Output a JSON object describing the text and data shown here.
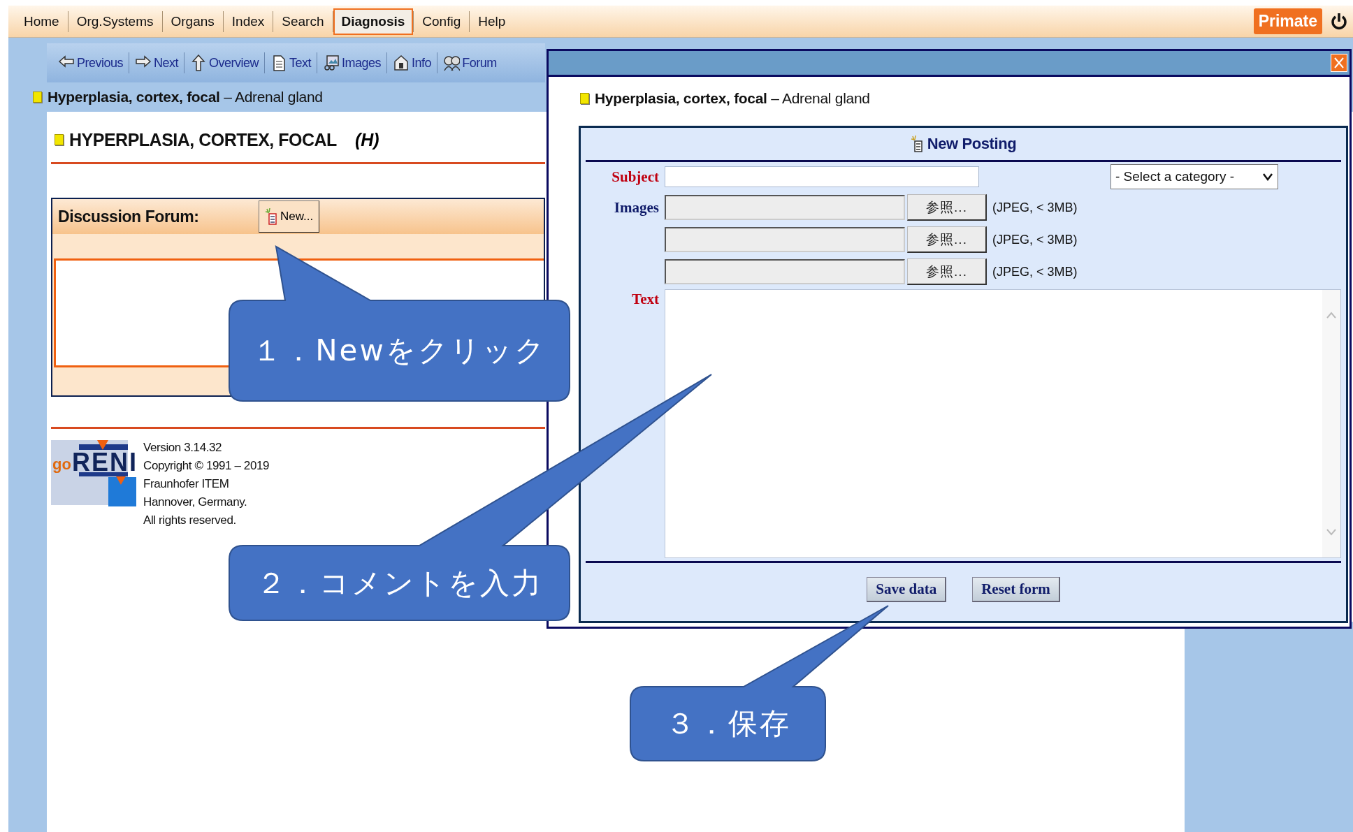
{
  "nav": {
    "tabs": [
      {
        "label": "Home",
        "selected": false
      },
      {
        "label": "Org.Systems",
        "selected": false
      },
      {
        "label": "Organs",
        "selected": false
      },
      {
        "label": "Index",
        "selected": false
      },
      {
        "label": "Search",
        "selected": false
      },
      {
        "label": "Diagnosis",
        "selected": true
      },
      {
        "label": "Config",
        "selected": false
      },
      {
        "label": "Help",
        "selected": false
      }
    ],
    "badge": "Primate"
  },
  "toolbar": [
    {
      "label": "Previous"
    },
    {
      "label": "Next"
    },
    {
      "label": "Overview"
    },
    {
      "label": "Text"
    },
    {
      "label": "Images"
    },
    {
      "label": "Info"
    },
    {
      "label": "Forum"
    }
  ],
  "breadcrumb": "**Hyperplasia, cortex, focal** – Adrenal gland",
  "heading": {
    "title": "HYPERPLASIA, CORTEX, FOCAL",
    "code": "(H)"
  },
  "forum": {
    "title": "Discussion Forum:",
    "new_button": "New..."
  },
  "footer": {
    "logo": {
      "prefix": "go",
      "name": "RENI"
    },
    "lines": [
      "Version 3.14.32",
      "Copyright © 1991 – 2019",
      "Fraunhofer ITEM",
      "Hannover, Germany.",
      "All rights reserved."
    ]
  },
  "dialog": {
    "breadcrumb": "**Hyperplasia, cortex, focal** – Adrenal gland",
    "form": {
      "title": "New Posting",
      "subject_label": "Subject",
      "category": "- Select a category -",
      "images_label": "Images",
      "images": [
        {
          "button": "参照...",
          "hint": "(JPEG, < 3MB)"
        },
        {
          "button": "参照...",
          "hint": "(JPEG, < 3MB)"
        },
        {
          "button": "参照...",
          "hint": "(JPEG, < 3MB)"
        }
      ],
      "text_label": "Text",
      "buttons": [
        "Save data",
        "Reset form"
      ]
    }
  },
  "callouts": [
    {
      "text": "１．Newをクリック"
    },
    {
      "text": "２．コメントを入力"
    },
    {
      "text": "３．保存"
    }
  ]
}
